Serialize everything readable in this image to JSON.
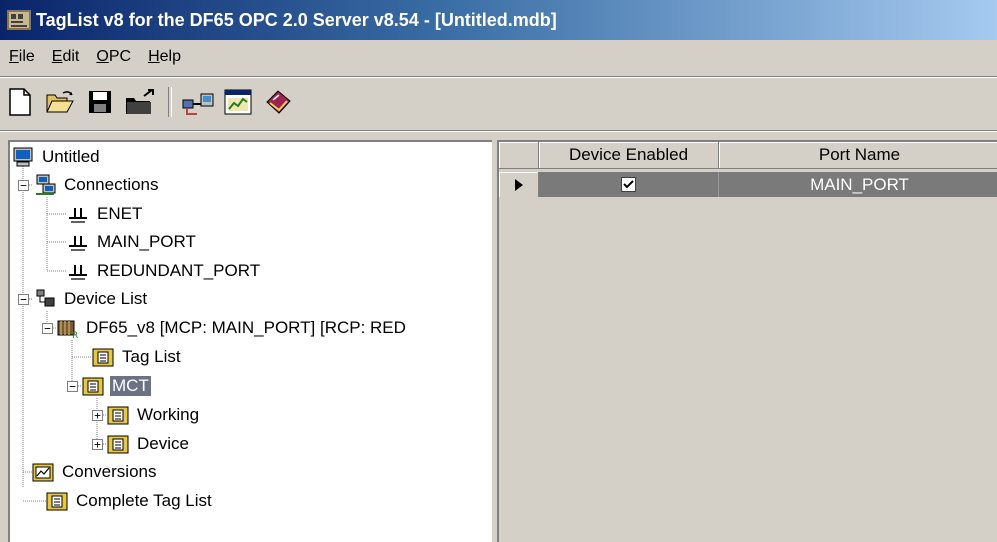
{
  "window": {
    "title": "TagList v8 for the DF65 OPC 2.0 Server v8.54 - [Untitled.mdb]"
  },
  "menu": [
    {
      "label": "File",
      "underline": "F",
      "rest": "ile"
    },
    {
      "label": "Edit",
      "underline": "E",
      "rest": "dit"
    },
    {
      "label": "OPC",
      "underline": "O",
      "rest": "PC"
    },
    {
      "label": "Help",
      "underline": "H",
      "rest": "elp"
    }
  ],
  "toolbar": {
    "buttons": [
      "new-document-icon",
      "open-folder-icon",
      "save-disk-icon",
      "export-folder-icon",
      "scan-devices-icon",
      "chart-window-icon",
      "help-book-icon"
    ]
  },
  "tree": {
    "root": "Untitled",
    "connections": "Connections",
    "enet": "ENET",
    "main_port": "MAIN_PORT",
    "redundant_port": "REDUNDANT_PORT",
    "device_list": "Device List",
    "device": "DF65_v8 [MCP: MAIN_PORT] [RCP: RED",
    "tag_list": "Tag List",
    "mct": "MCT",
    "working": "Working",
    "device_folder": "Device",
    "conversions": "Conversions",
    "complete_tag_list": "Complete Tag List"
  },
  "grid": {
    "columns": [
      "Device Enabled",
      "Port Name"
    ],
    "rows": [
      {
        "device_enabled": true,
        "port_name": "MAIN_PORT"
      }
    ]
  }
}
